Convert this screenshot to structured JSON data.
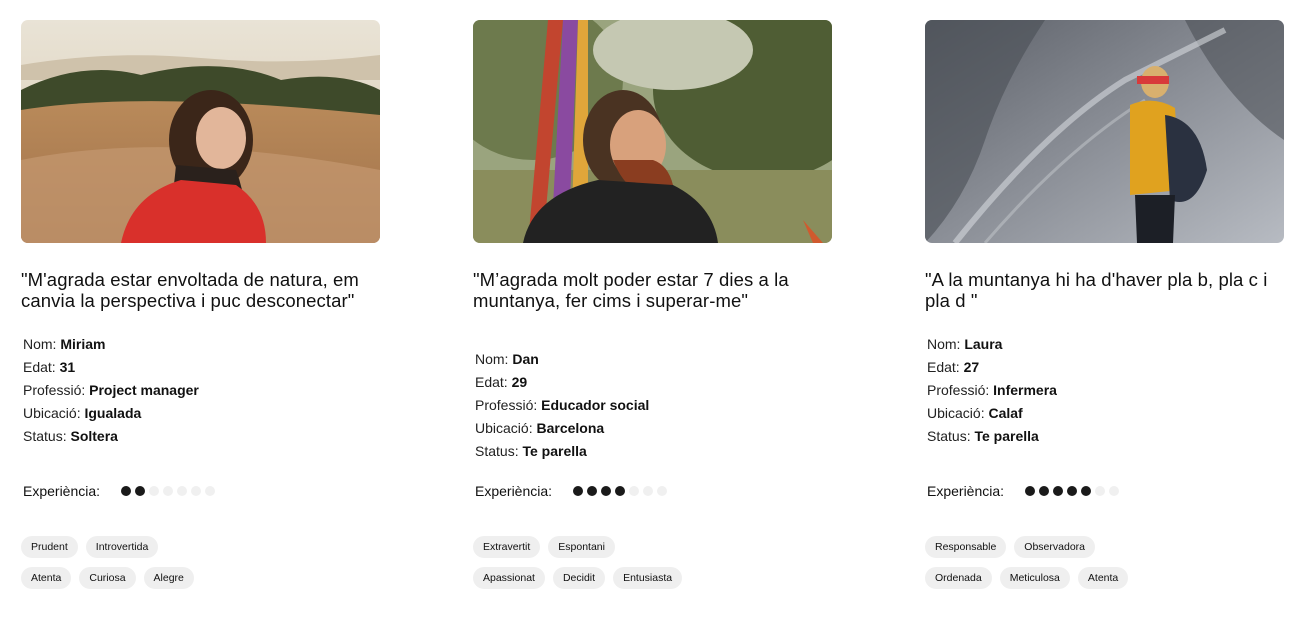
{
  "personas": [
    {
      "photo_alt": "Miriam-photo",
      "quote": "\"M'agrada estar envoltada de natura, em canvia la perspectiva i puc desconectar\"",
      "fields": {
        "nom_label": "Nom:",
        "nom": "Miriam",
        "edat_label": "Edat:",
        "edat": "31",
        "prof_label": "Professió:",
        "prof": "Project manager",
        "ubic_label": "Ubicació:",
        "ubic": "Igualada",
        "status_label": "Status:",
        "status": "Soltera"
      },
      "experience_label": "Experiència:",
      "experience_level": 2,
      "experience_max": 7,
      "tags_row1": [
        "Prudent",
        "Introvertida"
      ],
      "tags_row2": [
        "Atenta",
        "Curiosa",
        "Alegre"
      ]
    },
    {
      "photo_alt": "Dan-photo",
      "quote": "\"M’agrada molt poder estar 7 dies a la muntanya, fer cims i superar-me\"",
      "fields": {
        "nom_label": "Nom:",
        "nom": "Dan",
        "edat_label": "Edat:",
        "edat": "29",
        "prof_label": "Professió:",
        "prof": "Educador social",
        "ubic_label": "Ubicació:",
        "ubic": "Barcelona",
        "status_label": "Status:",
        "status": "Te parella"
      },
      "experience_label": "Experiència:",
      "experience_level": 4,
      "experience_max": 7,
      "tags_row1": [
        "Extravertit",
        "Espontani"
      ],
      "tags_row2": [
        "Apassionat",
        "Decidit",
        "Entusiasta"
      ]
    },
    {
      "photo_alt": "Laura-photo",
      "quote": "\"A la muntanya hi ha d'haver pla b, pla c i pla d \"",
      "fields": {
        "nom_label": "Nom:",
        "nom": "Laura",
        "edat_label": "Edat:",
        "edat": "27",
        "prof_label": "Professió:",
        "prof": "Infermera",
        "ubic_label": "Ubicació:",
        "ubic": "Calaf",
        "status_label": "Status:",
        "status": "Te parella"
      },
      "experience_label": "Experiència:",
      "experience_level": 5,
      "experience_max": 7,
      "tags_row1": [
        "Responsable",
        "Observadora"
      ],
      "tags_row2": [
        "Ordenada",
        "Meticulosa",
        "Atenta"
      ]
    }
  ],
  "colors": {
    "dot_on": "#1a1a1a",
    "dot_off": "#f0f0f0",
    "tag_bg": "#efefef"
  }
}
